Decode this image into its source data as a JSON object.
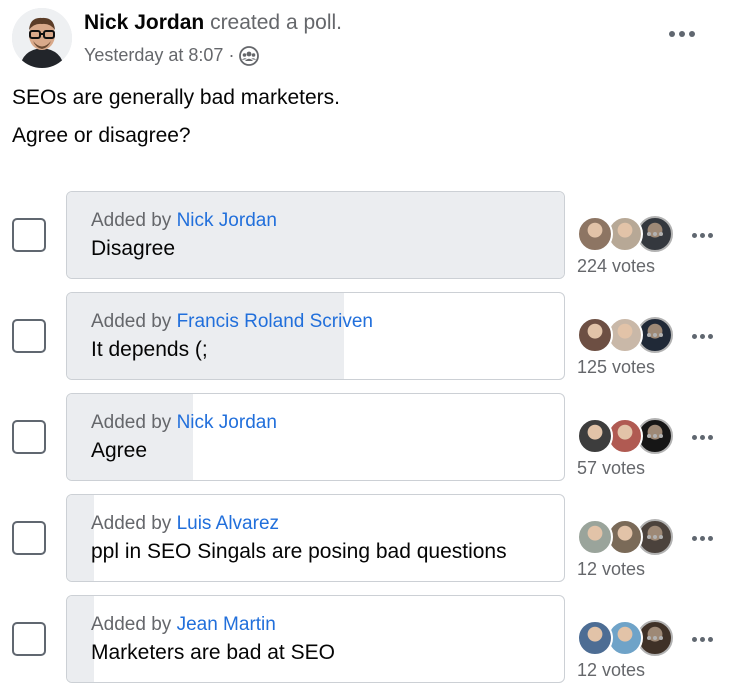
{
  "post": {
    "author": "Nick Jordan",
    "action": "created a poll.",
    "timestamp": "Yesterday at 8:07",
    "separator": "·",
    "audience_icon": "group-icon",
    "text_lines": [
      "SEOs are generally bad marketers.",
      "Agree or disagree?"
    ]
  },
  "poll": {
    "added_by_prefix": "Added by",
    "options": [
      {
        "added_by": "Nick Jordan",
        "label": "Disagree",
        "votes": "224 votes",
        "vote_count": 224,
        "fill_fraction": 1.0,
        "voter_colors": [
          "#8d7563",
          "#b7a896",
          "#4a5058"
        ]
      },
      {
        "added_by": "Francis Roland Scriven",
        "label": "It depends (;",
        "votes": "125 votes",
        "vote_count": 125,
        "fill_fraction": 0.558,
        "voter_colors": [
          "#6d4f43",
          "#c9b8a8",
          "#2e3a4f"
        ]
      },
      {
        "added_by": "Nick Jordan",
        "label": "Agree",
        "votes": "57 votes",
        "vote_count": 57,
        "fill_fraction": 0.254,
        "voter_colors": [
          "#3d3d3d",
          "#b05a52",
          "#1f1f1f"
        ]
      },
      {
        "added_by": "Luis Alvarez",
        "label": "ppl in SEO Singals are posing bad questions",
        "votes": "12 votes",
        "vote_count": 12,
        "fill_fraction": 0.054,
        "voter_colors": [
          "#9aa49b",
          "#7a6a58",
          "#6b5f55"
        ]
      },
      {
        "added_by": "Jean Martin",
        "label": "Marketers are bad at SEO",
        "votes": "12 votes",
        "vote_count": 12,
        "fill_fraction": 0.054,
        "voter_colors": [
          "#4d6d94",
          "#6fa3c8",
          "#5a4638"
        ]
      }
    ]
  },
  "colors": {
    "link_blue": "#216fdb",
    "secondary_text": "#65676b",
    "bar_fill": "#ebedf0",
    "bar_border": "#ccd0d5"
  }
}
